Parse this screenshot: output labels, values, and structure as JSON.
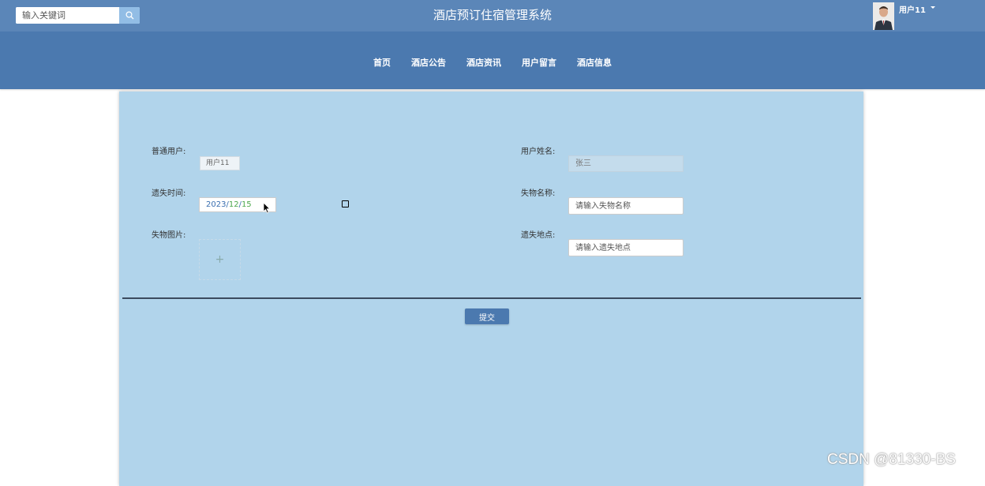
{
  "header": {
    "search_placeholder": "输入关键词",
    "title": "酒店预订住宿管理系统",
    "user_name": "用户11"
  },
  "nav": {
    "items": [
      "首页",
      "酒店公告",
      "酒店资讯",
      "用户留言",
      "酒店信息"
    ]
  },
  "form": {
    "user_label": "普通用户:",
    "user_value": "用户11",
    "name_label": "用户姓名:",
    "name_value": "张三",
    "lost_time_label": "遗失时间:",
    "lost_date": {
      "year": "2023",
      "month": "12",
      "day": "15",
      "sep": "/"
    },
    "item_name_label": "失物名称:",
    "item_name_placeholder": "请输入失物名称",
    "item_image_label": "失物图片:",
    "upload_plus": "+",
    "lost_place_label": "遗失地点:",
    "lost_place_placeholder": "请输入遗失地点",
    "submit_label": "提交"
  },
  "watermark": "CSDN @81330-BS",
  "colors": {
    "topbar": "#5b86b8",
    "navbar": "#4b79af",
    "panel": "#b1d4eb",
    "search_button": "#92bde5"
  }
}
